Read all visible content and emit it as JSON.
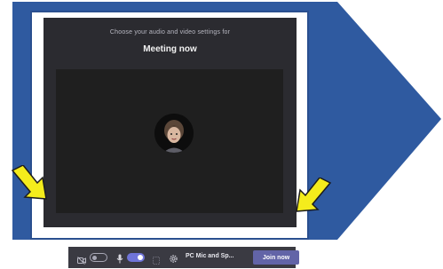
{
  "dialog": {
    "subtitle": "Choose your audio and video settings for",
    "title": "Meeting now"
  },
  "toolbar": {
    "camera_toggle_state": "off",
    "mic_toggle_state": "on",
    "device_label": "PC Mic and Sp...",
    "join_label": "Join now"
  },
  "colors": {
    "chevron": "#2f5aa0",
    "window_bg": "#2b2b30",
    "join_button": "#6264a7",
    "toggle_on": "#6f74d8",
    "annotation_arrow": "#f4ec1c"
  },
  "icons": [
    "camera-icon",
    "microphone-icon",
    "blur-icon",
    "settings-gear-icon",
    "arrow-annotation-icon"
  ]
}
